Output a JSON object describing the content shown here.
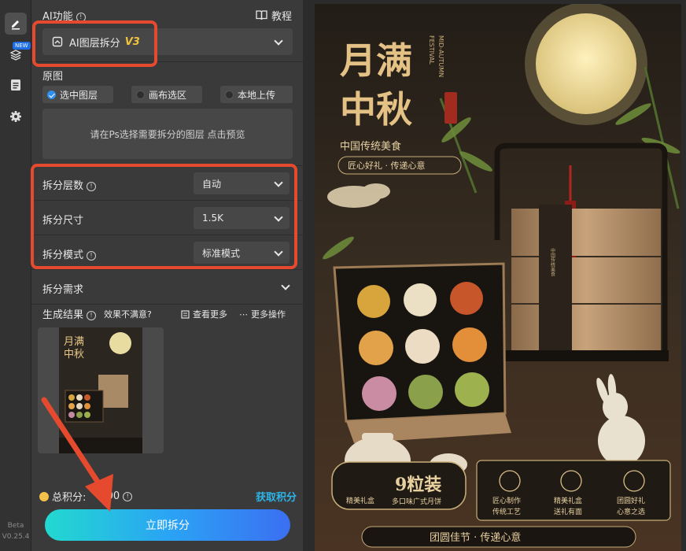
{
  "rail": {
    "new_badge": "NEW",
    "version_line1": "Beta",
    "version_line2": "V0.25.4"
  },
  "panel": {
    "ai_function_label": "AI功能",
    "tutorial_label": "教程",
    "function_select": {
      "label": "AI图层拆分",
      "version": "V3"
    },
    "source_label": "原图",
    "source_options": [
      {
        "label": "选中图层",
        "selected": true
      },
      {
        "label": "画布选区",
        "selected": false
      },
      {
        "label": "本地上传",
        "selected": false
      }
    ],
    "dropzone_text": "请在Ps选择需要拆分的图层 点击预览",
    "settings": [
      {
        "label": "拆分层数",
        "has_info": true,
        "value": "自动"
      },
      {
        "label": "拆分尺寸",
        "has_info": false,
        "value": "1.5K"
      },
      {
        "label": "拆分模式",
        "has_info": true,
        "value": "标准模式"
      }
    ],
    "requirement_label": "拆分需求",
    "result_label": "生成结果",
    "unsatisfied_label": "效果不满意?",
    "view_more_label": "查看更多",
    "more_actions_label": "更多操作",
    "credits_label": "总积分:",
    "credits_value": "300",
    "get_credits_label": "获取积分",
    "submit_label": "立即拆分"
  },
  "poster": {
    "title_line1": "月满",
    "title_line2": "中秋",
    "english_line1": "MID-AUTUMN",
    "english_line2": "FESTIVAL",
    "seal_text": "传统佳节",
    "subtitle": "中国传统美食",
    "tagline": "匠心好礼 · 传递心意",
    "box_label": "中国传统美食",
    "count_title": "9粒装",
    "count_badge": "精美礼盒",
    "count_sub": "多口味广式月饼",
    "features": [
      {
        "line1": "匠心制作",
        "line2": "传统工艺"
      },
      {
        "line1": "精美礼盒",
        "line2": "送礼有面"
      },
      {
        "line1": "团圆好礼",
        "line2": "心意之选"
      }
    ],
    "footer": "团圆佳节 · 传递心意"
  },
  "colors": {
    "accent_gold": "#f0c33c",
    "highlight_red": "#e64a2e",
    "link_blue": "#2db4e8",
    "radio_blue": "#2f8ff0"
  }
}
